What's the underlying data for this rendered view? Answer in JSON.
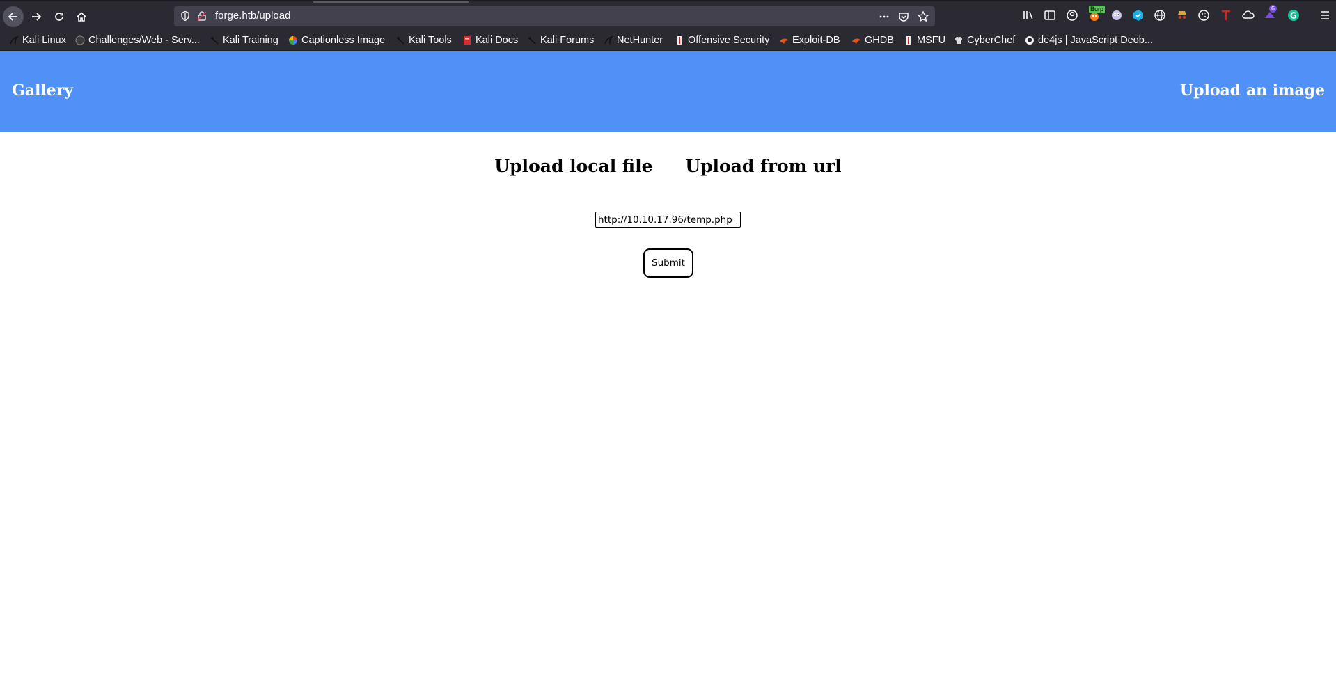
{
  "browser": {
    "url": "forge.htb/upload",
    "extensions": {
      "burp_badge": "Burp",
      "badge_count": "6"
    },
    "bookmarks": [
      {
        "label": "Kali Linux",
        "icon": "kali-dragon-icon"
      },
      {
        "label": "Challenges/Web - Serv...",
        "icon": "globe-icon"
      },
      {
        "label": "Kali Training",
        "icon": "kali-dragon-icon"
      },
      {
        "label": "Captionless Image",
        "icon": "pinwheel-icon"
      },
      {
        "label": "Kali Tools",
        "icon": "kali-dragon-icon"
      },
      {
        "label": "Kali Docs",
        "icon": "kali-docs-icon"
      },
      {
        "label": "Kali Forums",
        "icon": "kali-dragon-icon"
      },
      {
        "label": "NetHunter",
        "icon": "kali-dragon-icon"
      },
      {
        "label": "Offensive Security",
        "icon": "offsec-icon"
      },
      {
        "label": "Exploit-DB",
        "icon": "exploit-db-icon"
      },
      {
        "label": "GHDB",
        "icon": "exploit-db-icon"
      },
      {
        "label": "MSFU",
        "icon": "offsec-icon"
      },
      {
        "label": "CyberChef",
        "icon": "chef-hat-icon"
      },
      {
        "label": "de4js | JavaScript Deob...",
        "icon": "github-icon"
      }
    ]
  },
  "header": {
    "brand": "Gallery",
    "upload_link": "Upload an image"
  },
  "upload": {
    "tab_local": "Upload local file",
    "tab_url": "Upload from url",
    "url_value": "http://10.10.17.96/temp.php",
    "submit_label": "Submit"
  },
  "colors": {
    "header_bg": "#5091f8",
    "chrome_bg": "#2b2a33",
    "urlbar_bg": "#42414d"
  }
}
